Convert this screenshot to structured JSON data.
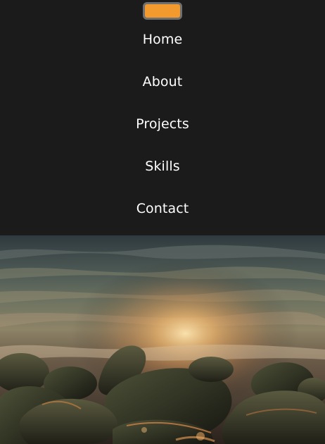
{
  "nav": {
    "items": [
      {
        "label": "Home"
      },
      {
        "label": "About"
      },
      {
        "label": "Projects"
      },
      {
        "label": "Skills"
      },
      {
        "label": "Contact"
      }
    ]
  },
  "colors": {
    "nav_background": "#1b1b1b",
    "menu_button": "#f29a2e",
    "menu_button_border": "#6f6f6f",
    "link_text": "#ffffff"
  },
  "hero": {
    "icon": "sunset-beach-rocks-image"
  }
}
